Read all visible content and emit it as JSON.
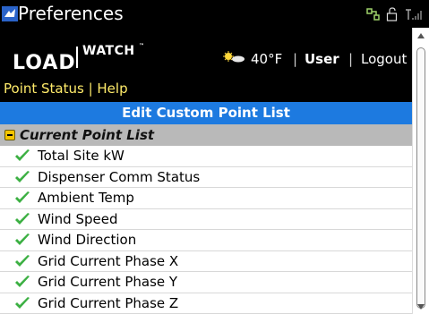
{
  "titlebar": {
    "title": "Preferences",
    "icons": [
      "app-icon",
      "network-icon",
      "lock-icon",
      "signal-icon"
    ]
  },
  "header": {
    "logo_primary": "LOAD",
    "logo_secondary": "WATCH",
    "logo_tm": "™",
    "weather_icon": "sun-cloud-icon",
    "temperature": "40°F",
    "separator": "|",
    "user_label": "User",
    "logout_label": "Logout",
    "nav": {
      "point_status": "Point Status",
      "nav_separator": " | ",
      "help": "Help"
    }
  },
  "banner": {
    "title": "Edit Custom Point List"
  },
  "section": {
    "title": "Current Point List",
    "icon": "collapse-minus-icon"
  },
  "points": [
    {
      "label": "Total Site kW",
      "checked": true
    },
    {
      "label": "Dispenser Comm Status",
      "checked": true
    },
    {
      "label": "Ambient Temp",
      "checked": true
    },
    {
      "label": "Wind Speed",
      "checked": true
    },
    {
      "label": "Wind Direction",
      "checked": true
    },
    {
      "label": "Grid Current Phase X",
      "checked": true
    },
    {
      "label": "Grid Current Phase Y",
      "checked": true
    },
    {
      "label": "Grid Current Phase Z",
      "checked": true
    }
  ],
  "colors": {
    "banner": "#1d7ae0",
    "nav_link": "#ffeb6a",
    "section_bg": "#b9b9b9",
    "check": "#3cb043"
  }
}
